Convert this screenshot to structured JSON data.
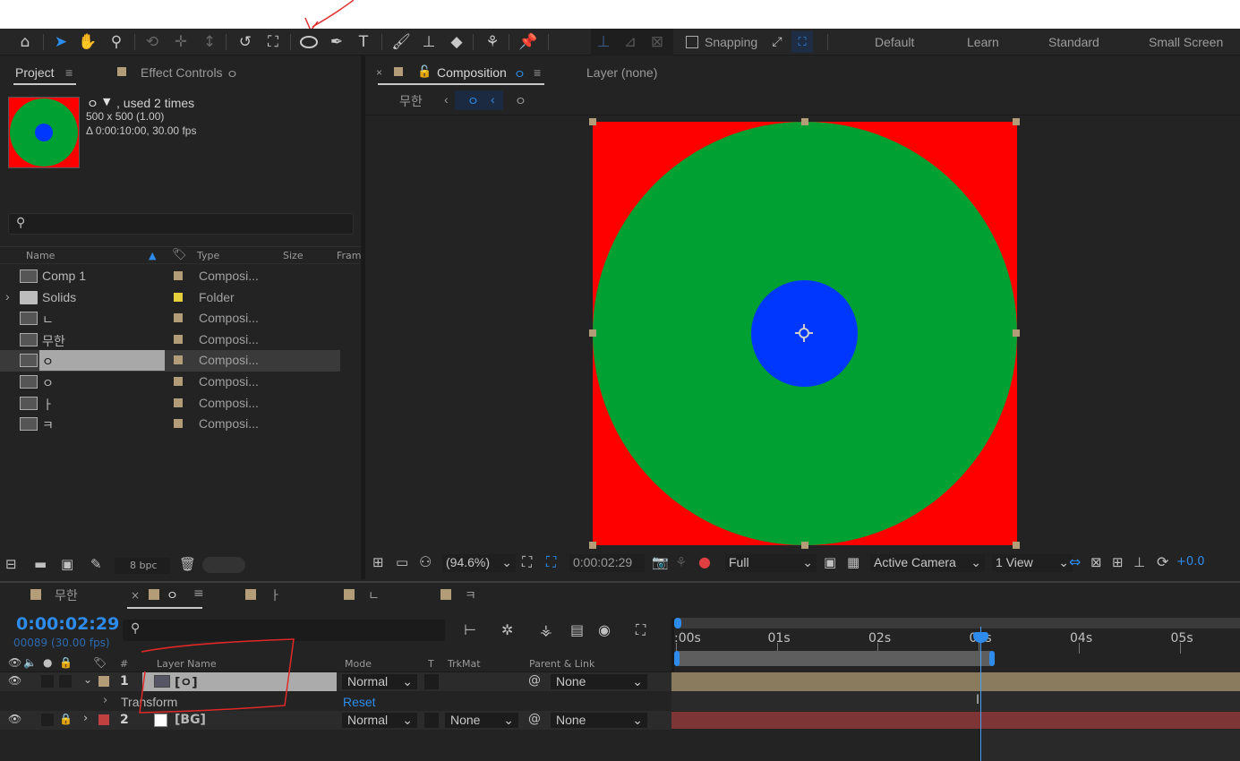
{
  "toolbar": {
    "snapping_label": "Snapping",
    "workspaces": [
      "Default",
      "Learn",
      "Standard",
      "Small Screen"
    ],
    "tools": [
      "home-icon",
      "selection-tool-icon",
      "hand-tool-icon",
      "zoom-tool-icon",
      "orbit-camera-icon",
      "pan-camera-icon",
      "dolly-camera-icon",
      "rotation-tool-icon",
      "pan-behind-icon",
      "ellipse-tool-icon",
      "pen-tool-icon",
      "type-tool-icon",
      "brush-tool-icon",
      "clone-stamp-icon",
      "eraser-icon",
      "roto-brush-icon",
      "puppet-pin-icon"
    ]
  },
  "project_panel": {
    "tab_project": "Project",
    "tab_effect_controls": "Effect Controls",
    "effect_controls_target": "ㅇ",
    "selected_name": "ㅇ",
    "usage": ", used 2 times",
    "dimensions": "500 x 500 (1.00)",
    "duration": "Δ 0:00:10:00, 30.00 fps",
    "columns": [
      "Name",
      "Type",
      "Size",
      "Fram"
    ],
    "items": [
      {
        "name": "Comp 1",
        "type": "Composi...",
        "label_color": "#b39c78",
        "kind": "comp"
      },
      {
        "name": "Solids",
        "type": "Folder",
        "label_color": "#e5cf3c",
        "kind": "folder"
      },
      {
        "name": "ㄴ",
        "type": "Composi...",
        "label_color": "#b39c78",
        "kind": "comp"
      },
      {
        "name": "무한",
        "type": "Composi...",
        "label_color": "#b39c78",
        "kind": "comp"
      },
      {
        "name": "ㅇ",
        "type": "Composi...",
        "label_color": "#b39c78",
        "kind": "comp",
        "selected": true
      },
      {
        "name": "ㅇ",
        "type": "Composi...",
        "label_color": "#b39c78",
        "kind": "comp"
      },
      {
        "name": "ㅏ",
        "type": "Composi...",
        "label_color": "#b39c78",
        "kind": "comp"
      },
      {
        "name": "ㅋ",
        "type": "Composi...",
        "label_color": "#b39c78",
        "kind": "comp"
      }
    ],
    "bpc": "8 bpc"
  },
  "composition_panel": {
    "tab_label": "Composition",
    "tab_target": "ㅇ",
    "layer_tab": "Layer  (none)",
    "breadcrumb_parent": "무한",
    "breadcrumb_current": "ㅇ",
    "breadcrumb_next": "ㅇ",
    "zoom": "(94.6%)",
    "timecode": "0:00:02:29",
    "resolution": "Full",
    "camera": "Active Camera",
    "views": "1 View",
    "exposure": "+0.0",
    "colors": {
      "background": "#ff0000",
      "outer_circle": "#00a032",
      "inner_circle": "#0037ff"
    }
  },
  "timeline": {
    "tabs": [
      "무한",
      "ㅇ",
      "ㅏ",
      "ㄴ",
      "ㅋ"
    ],
    "active_tab": "ㅇ",
    "current_time": "0:00:02:29",
    "frame_info": "00089 (30.00 fps)",
    "ruler_labels": [
      ":00s",
      "01s",
      "02s",
      "03s",
      "04s",
      "05s"
    ],
    "column_headers": {
      "num": "#",
      "layer_name": "Layer Name",
      "mode": "Mode",
      "t": "T",
      "trkmat": "TrkMat",
      "parent": "Parent & Link"
    },
    "layers": [
      {
        "num": "1",
        "name": "[ㅇ]",
        "mode": "Normal",
        "trkmat": "",
        "parent": "None",
        "label_color": "#b39c78",
        "bar_color": "#8a7a5e"
      },
      {
        "num": "2",
        "name": "[BG]",
        "mode": "Normal",
        "trkmat": "None",
        "parent": "None",
        "label_color": "#c04040",
        "bar_color": "#7d3535"
      }
    ],
    "transform_label": "Transform",
    "reset_label": "Reset"
  }
}
